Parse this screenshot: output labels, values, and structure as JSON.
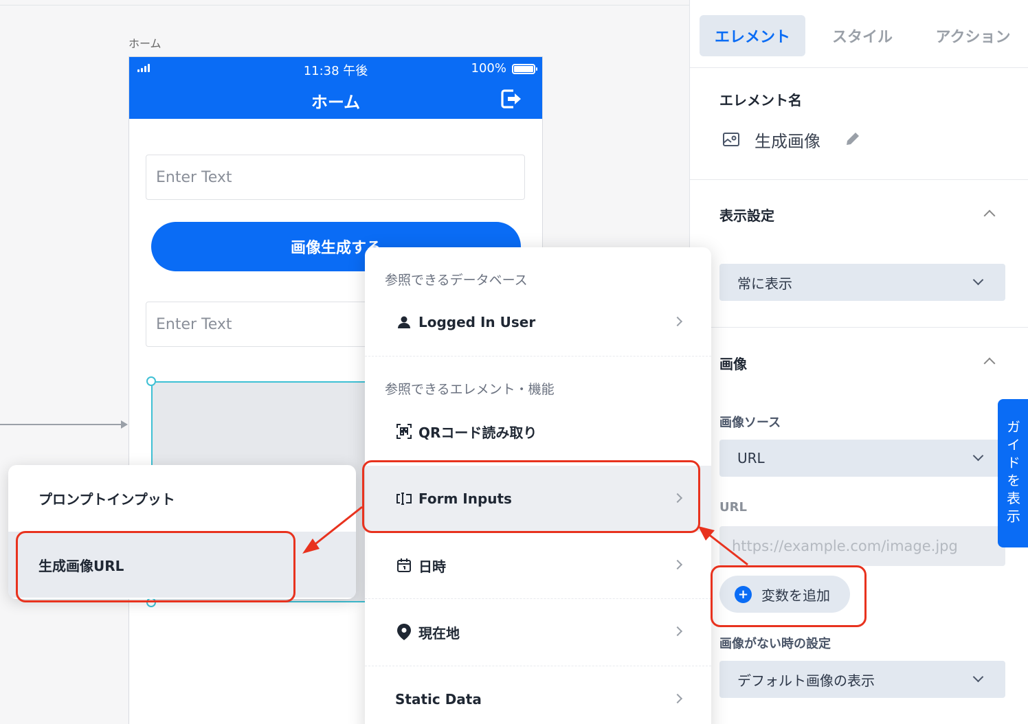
{
  "canvas": {
    "screen_label": "ホーム"
  },
  "phone": {
    "status": {
      "time": "11:38 午後",
      "battery": "100%"
    },
    "header_title": "ホーム",
    "input1_placeholder": "Enter Text",
    "generate_button": "画像生成する",
    "input2_placeholder": "Enter Text"
  },
  "panel": {
    "tabs": [
      {
        "label": "エレメント",
        "active": true
      },
      {
        "label": "スタイル",
        "active": false
      },
      {
        "label": "アクション",
        "active": false
      }
    ],
    "element_name_title": "エレメント名",
    "element_name": "生成画像",
    "display_settings_title": "表示設定",
    "display_select": "常に表示",
    "image_title": "画像",
    "image_source_label": "画像ソース",
    "image_source_value": "URL",
    "url_label": "URL",
    "url_placeholder": "https://example.com/image.jpg",
    "add_variable": "変数を追加",
    "no_image_label": "画像がない時の設定",
    "no_image_value": "デフォルト画像の表示",
    "guide_tab": "ガイドを表示"
  },
  "menu": {
    "section1": "参照できるデータベース",
    "logged_in_user": "Logged In User",
    "section2": "参照できるエレメント・機能",
    "qr": "QRコード読み取り",
    "form_inputs": "Form Inputs",
    "datetime": "日時",
    "location": "現在地",
    "static_data": "Static Data"
  },
  "submenu": {
    "prompt_input": "プロンプトインプット",
    "generated_image_url": "生成画像URL"
  },
  "colors": {
    "primary": "#0a6cf5",
    "annotation_red": "#e8321e",
    "selection": "#3ec0d4"
  }
}
